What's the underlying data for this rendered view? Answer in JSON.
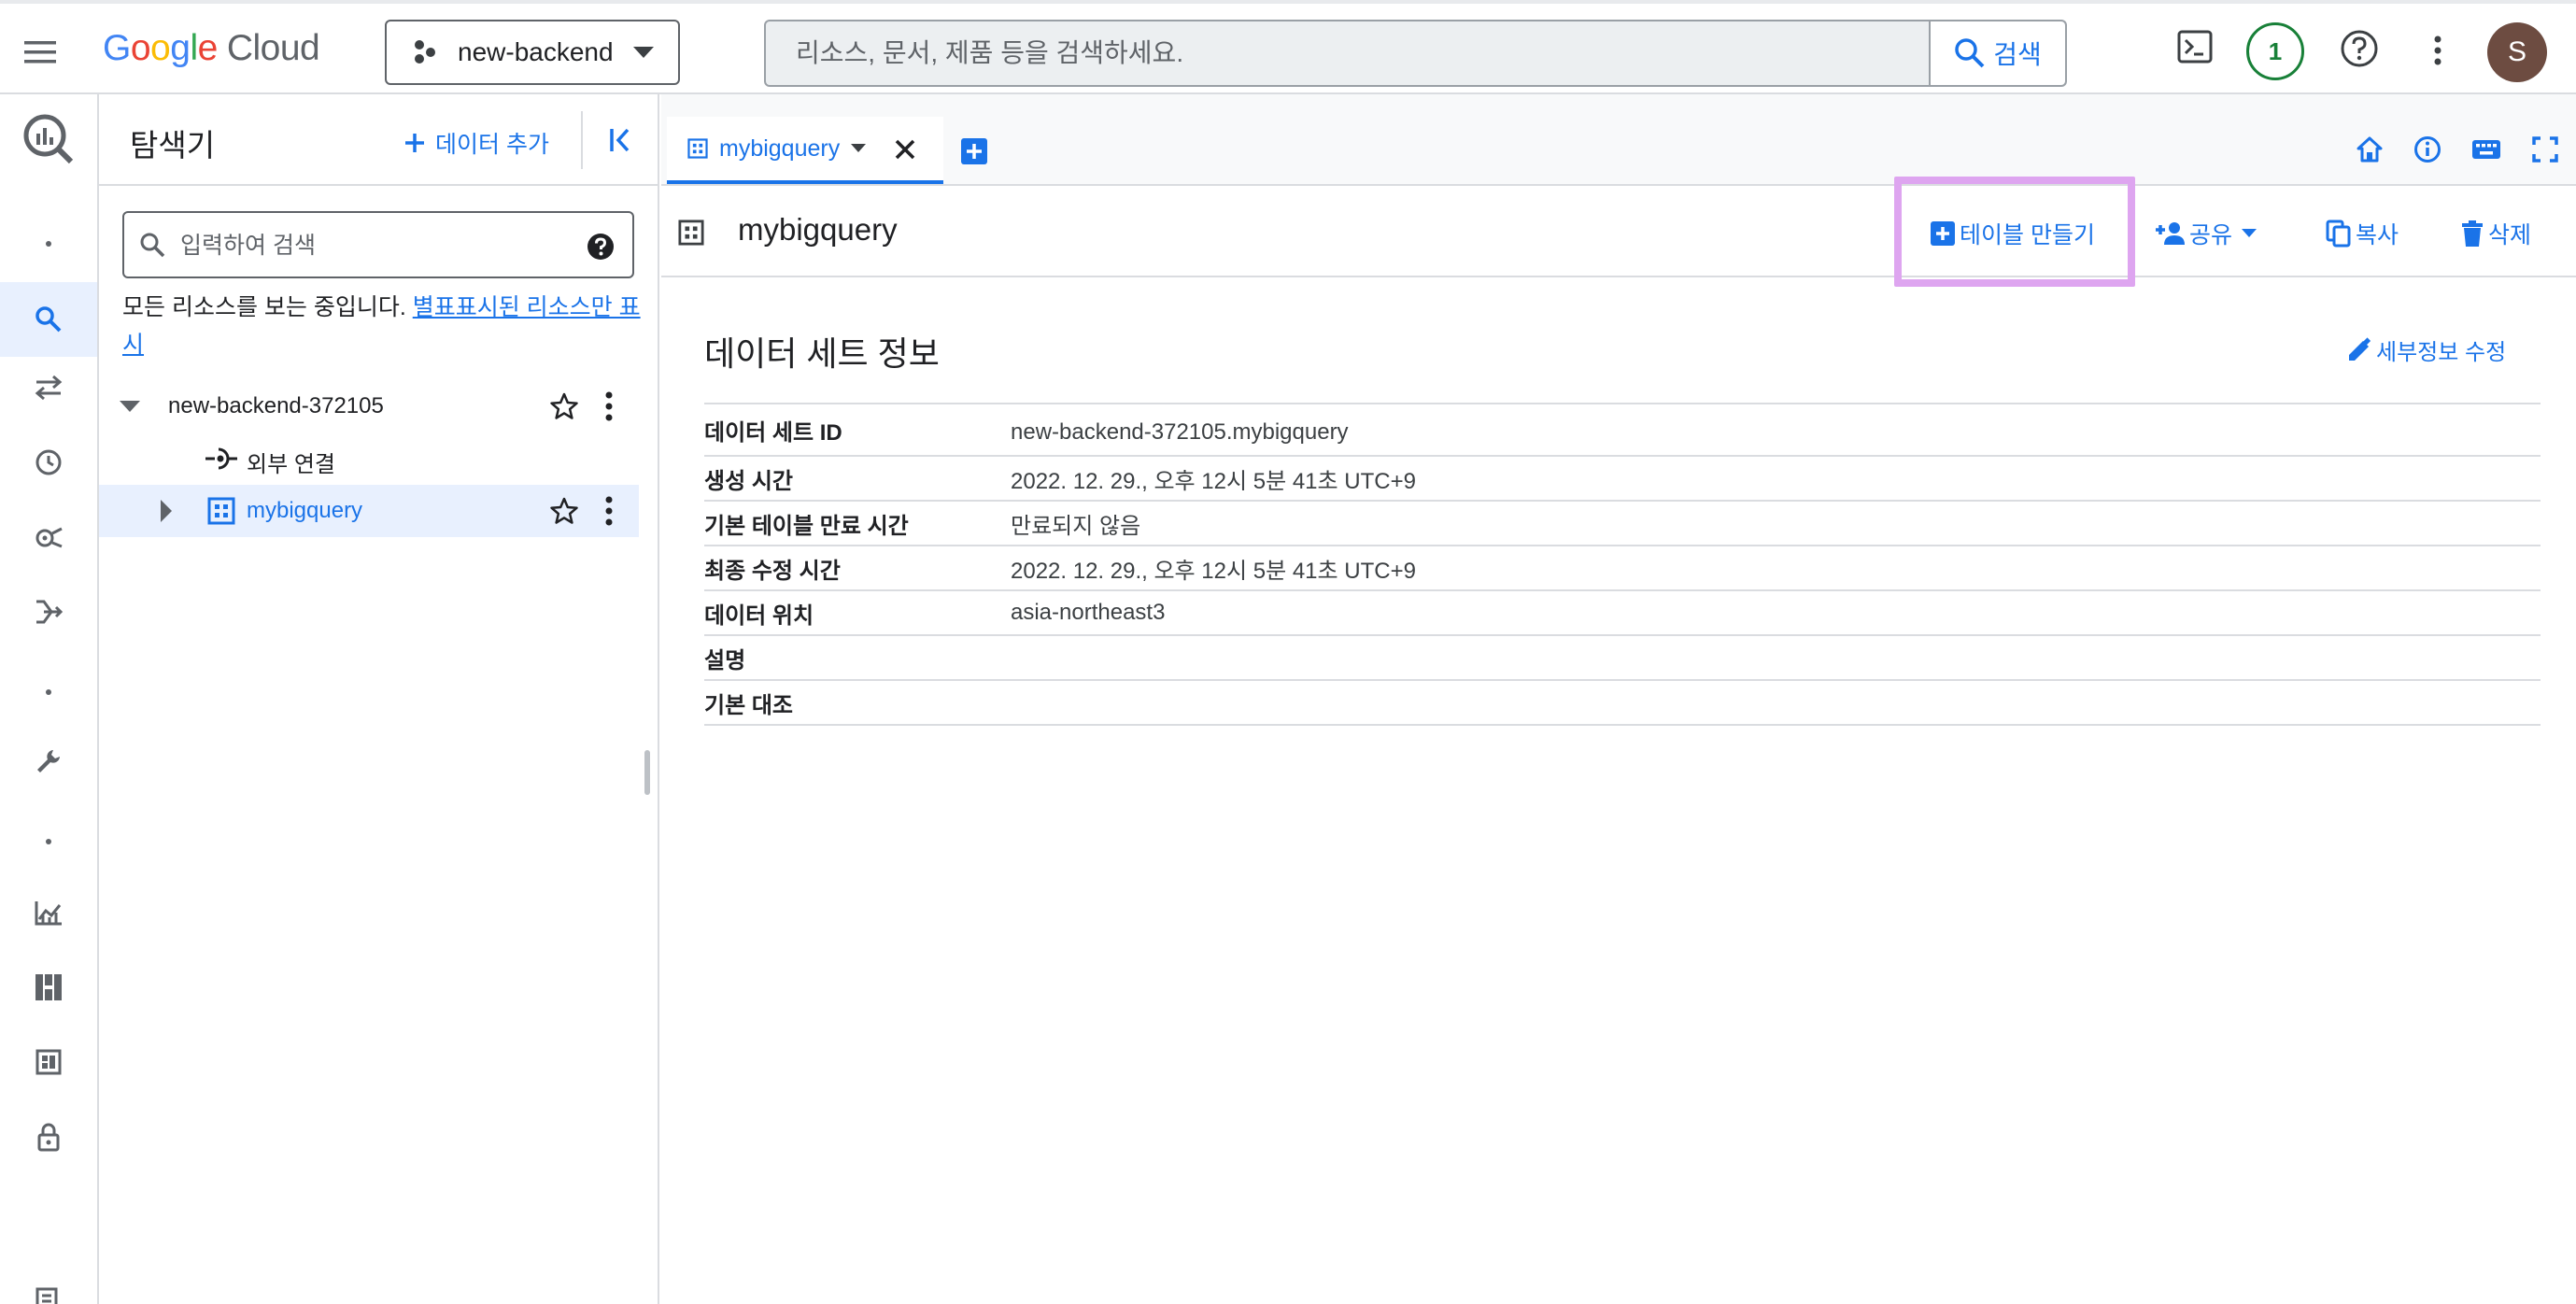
{
  "topbar": {
    "logo_letters": [
      "G",
      "o",
      "o",
      "g",
      "l",
      "e"
    ],
    "logo_product": "Cloud",
    "project_name": "new-backend",
    "search_placeholder": "리소스, 문서, 제품 등을 검색하세요.",
    "search_button": "검색",
    "notification_count": "1",
    "avatar_initial": "S"
  },
  "explorer": {
    "title": "탐색기",
    "add_data": "데이터 추가",
    "search_placeholder": "입력하여 검색",
    "scope_note": "모든 리소스를 보는 중입니다. ",
    "scope_link": "별표표시된 리소스만 표시",
    "tree": {
      "project": "new-backend-372105",
      "external": "외부 연결",
      "dataset": "mybigquery"
    }
  },
  "tabs": [
    {
      "label": "mybigquery"
    }
  ],
  "toolbar": {
    "dataset_title": "mybigquery",
    "create_table": "테이블 만들기",
    "share": "공유",
    "copy": "복사",
    "delete": "삭제"
  },
  "details": {
    "title": "데이터 세트 정보",
    "edit": "세부정보 수정",
    "rows": [
      {
        "key": "데이터 세트 ID",
        "value": "new-backend-372105.mybigquery"
      },
      {
        "key": "생성 시간",
        "value": "2022. 12. 29., 오후 12시 5분 41초 UTC+9"
      },
      {
        "key": "기본 테이블 만료 시간",
        "value": "만료되지 않음"
      },
      {
        "key": "최종 수정 시간",
        "value": "2022. 12. 29., 오후 12시 5분 41초 UTC+9"
      },
      {
        "key": "데이터 위치",
        "value": "asia-northeast3"
      },
      {
        "key": "설명",
        "value": ""
      },
      {
        "key": "기본 대조",
        "value": ""
      }
    ]
  },
  "icons": {
    "rail": [
      "bigquery-logo-icon",
      "search-icon",
      "transfers-icon",
      "history-icon",
      "scheduled-queries-icon",
      "workflow-icon",
      "wrench-icon",
      "monitoring-icon",
      "capacity-icon",
      "dashboard-icon",
      "lock-icon",
      "policy-icon"
    ],
    "topbar": [
      "menu-icon",
      "project-icon",
      "search-icon",
      "terminal-icon",
      "help-icon",
      "more-vert-icon"
    ]
  },
  "colors": {
    "accent": "#1a73e8",
    "highlight": "#dea5f0",
    "selected_bg": "#e8f0fe",
    "notif": "#188038",
    "avatar": "#6d4c41"
  }
}
